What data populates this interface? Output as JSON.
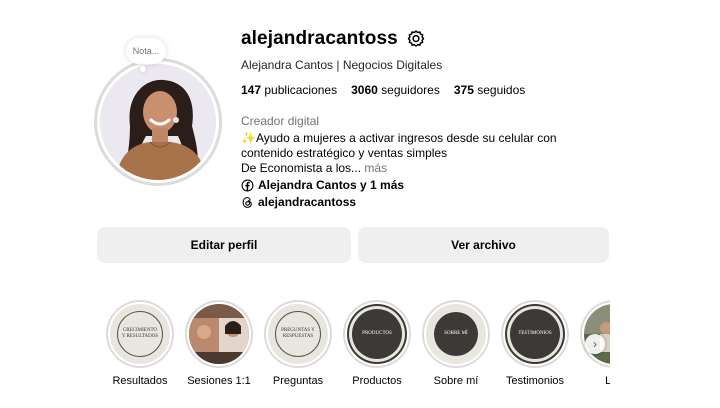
{
  "profile": {
    "username": "alejandracantoss",
    "full_name": "Alejandra Cantos | Negocios Digitales",
    "note_placeholder": "Nota...",
    "category": "Creador digital",
    "bio_line1": "✨Ayudo a mujeres a activar ingresos desde su celular con contenido estratégico y ventas simples",
    "bio_line2": "De Economista a los...",
    "bio_more": "más",
    "facebook_link": "Alejandra Cantos y 1 más",
    "threads_link": "alejandracantoss"
  },
  "stats": {
    "posts_value": "147",
    "posts_label": "publicaciones",
    "followers_value": "3060",
    "followers_label": "seguidores",
    "following_value": "375",
    "following_label": "seguidos"
  },
  "buttons": {
    "edit_profile": "Editar perfil",
    "view_archive": "Ver archivo"
  },
  "highlights": [
    {
      "label": "Resultados",
      "cover_text": "Crecimiento y resultados"
    },
    {
      "label": "Sesiones 1:1",
      "cover_text": ""
    },
    {
      "label": "Preguntas",
      "cover_text": "Preguntas y respuestas"
    },
    {
      "label": "Productos",
      "cover_text": "Productos"
    },
    {
      "label": "Sobre mí",
      "cover_text": "Sobre mí"
    },
    {
      "label": "Testimonios",
      "cover_text": "Testimonios"
    },
    {
      "label": "Life",
      "cover_text": ""
    }
  ],
  "colors": {
    "button_bg": "#efefef",
    "secondary_text": "#737373",
    "ring": "#dbdbdb",
    "highlight_beige": "#e9e6df",
    "highlight_dark": "#3c3a37"
  }
}
